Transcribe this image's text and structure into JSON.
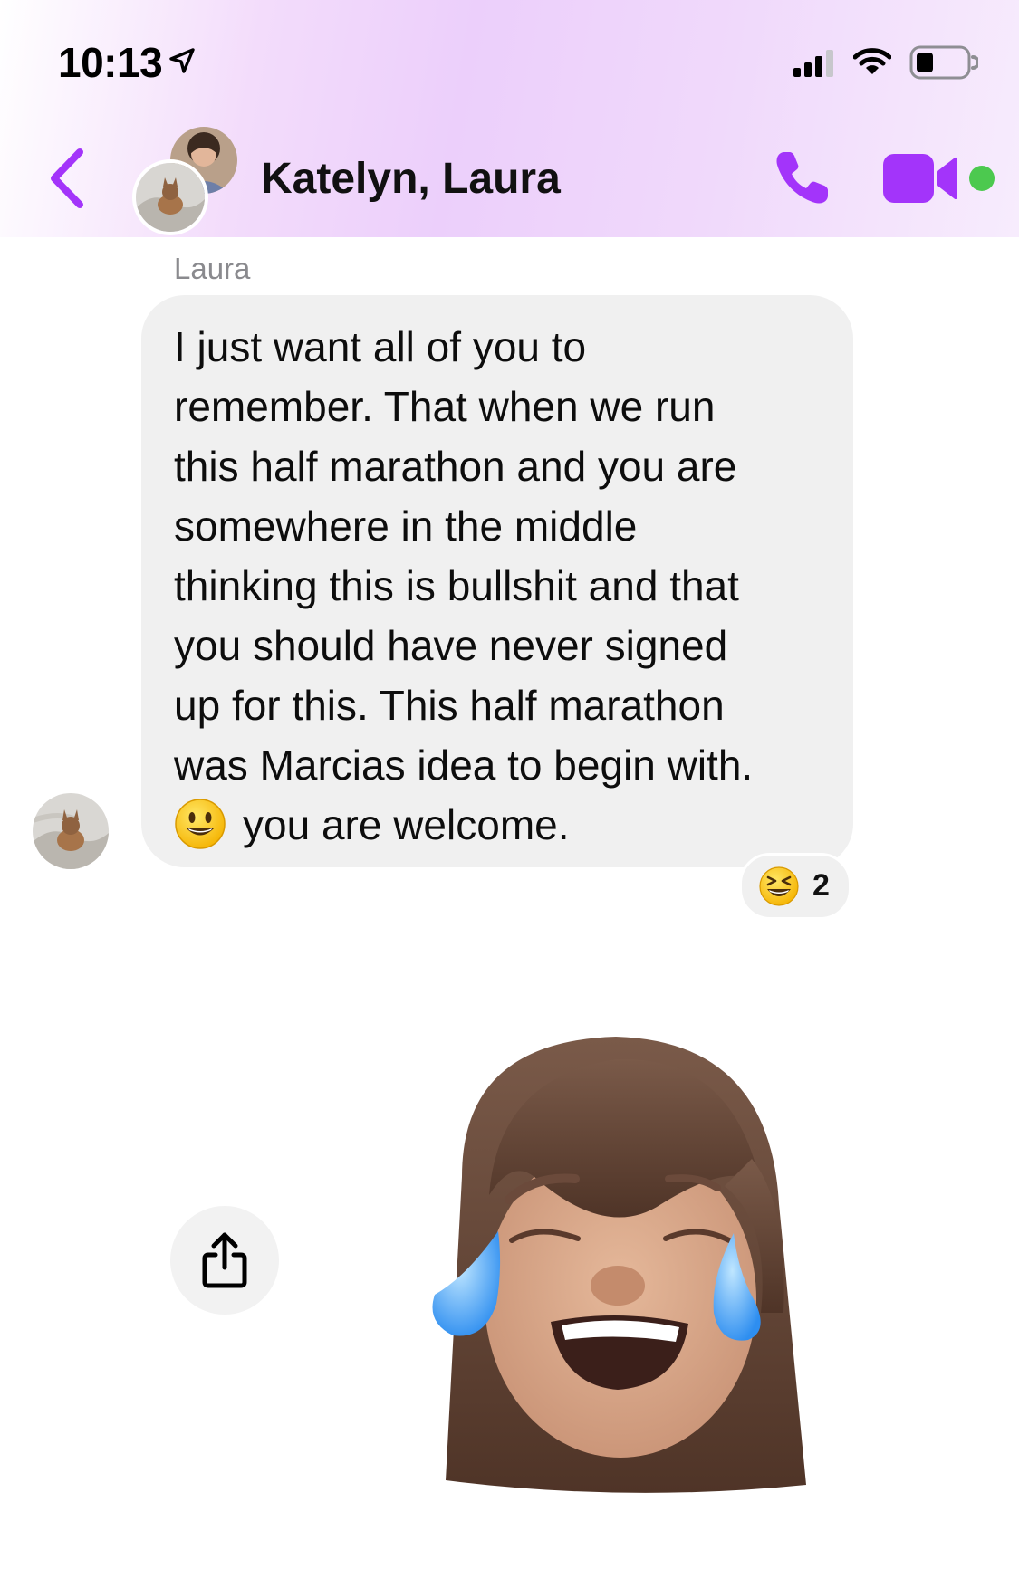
{
  "status_bar": {
    "time": "10:13",
    "icons": [
      "location-arrow-icon",
      "cellular-signal-icon",
      "wifi-icon",
      "battery-icon"
    ]
  },
  "header": {
    "back_icon": "chevron-left-icon",
    "title": "Katelyn, Laura",
    "call_icon": "phone-icon",
    "video_icon": "video-camera-icon",
    "online_status": "active",
    "accent_color": "#a334fa",
    "online_color": "#4cc94f"
  },
  "conversation": {
    "messages": [
      {
        "sender": "Laura",
        "lines": [
          "I just want all of you to",
          "remember. That when we run",
          "this half marathon and you are",
          "somewhere in the middle",
          "thinking this is bullshit and that",
          "you should have never signed",
          "up for this. This half marathon",
          "was Marcias idea to begin with."
        ],
        "last_line_emoji": "smiling-face-emoji",
        "last_line_text": "you are welcome.",
        "reaction": {
          "emoji": "grinning-squinting-face-emoji",
          "count": "2"
        }
      },
      {
        "type": "memoji-sticker",
        "sticker": "laughing-crying-memoji",
        "share_icon": "share-icon"
      }
    ]
  }
}
